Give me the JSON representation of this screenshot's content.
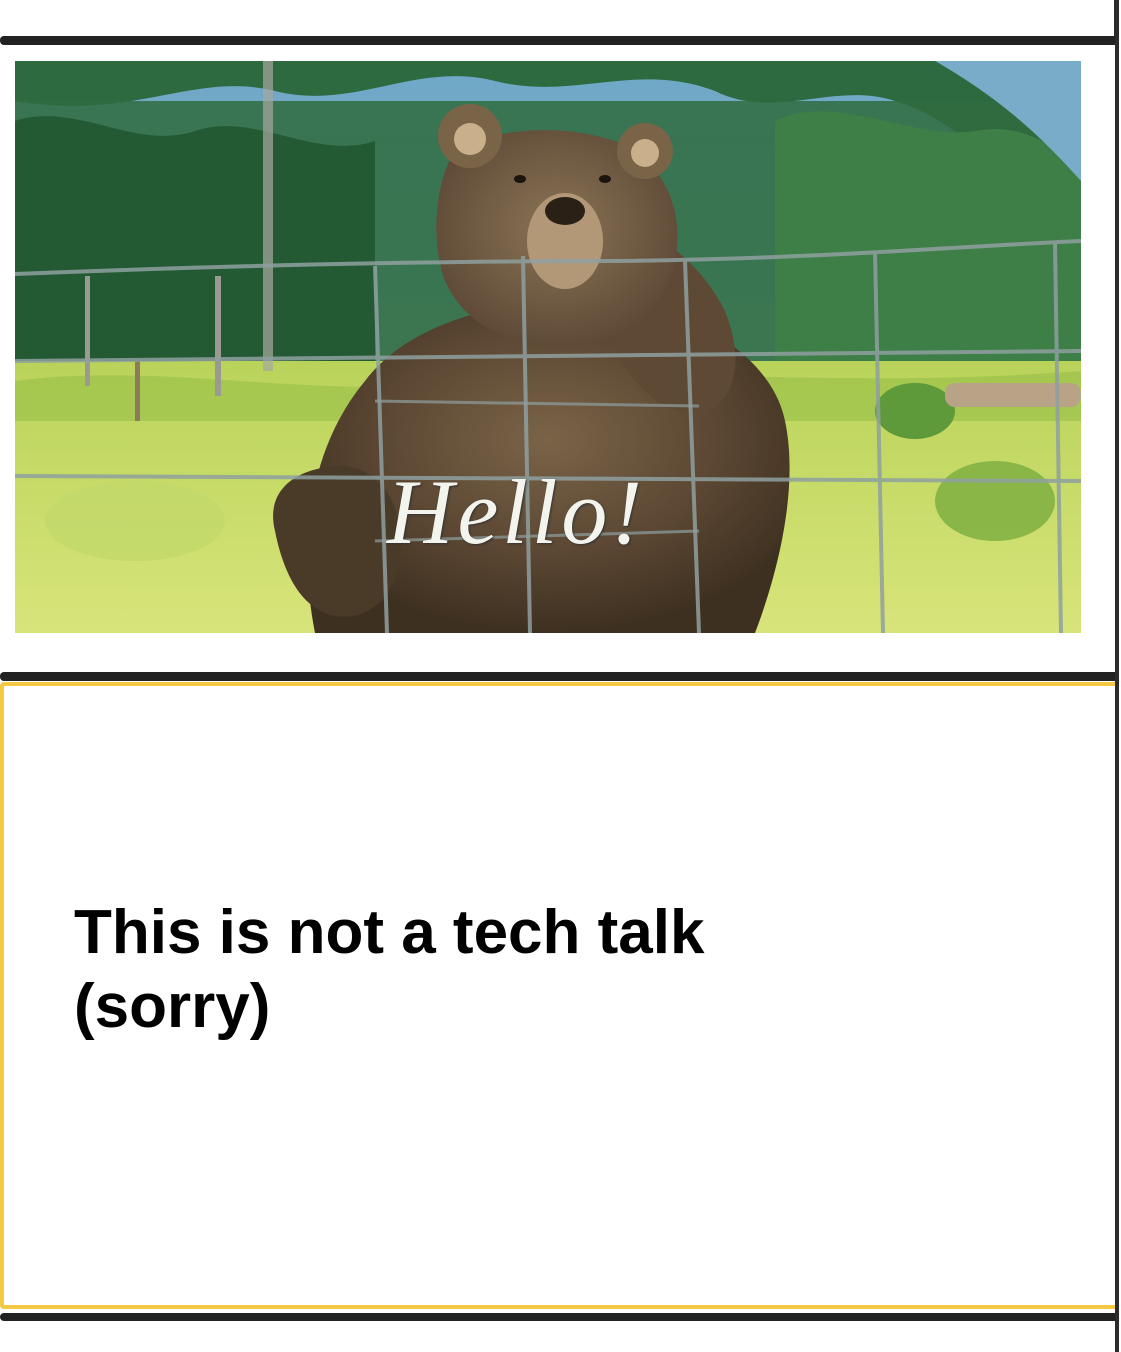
{
  "slides": [
    {
      "type": "image",
      "overlay_text": "Hello!"
    },
    {
      "type": "text",
      "title_line1": "This is not a tech talk",
      "title_line2": "(sorry)"
    }
  ],
  "colors": {
    "selected_border": "#f5c842",
    "divider": "#222222"
  }
}
